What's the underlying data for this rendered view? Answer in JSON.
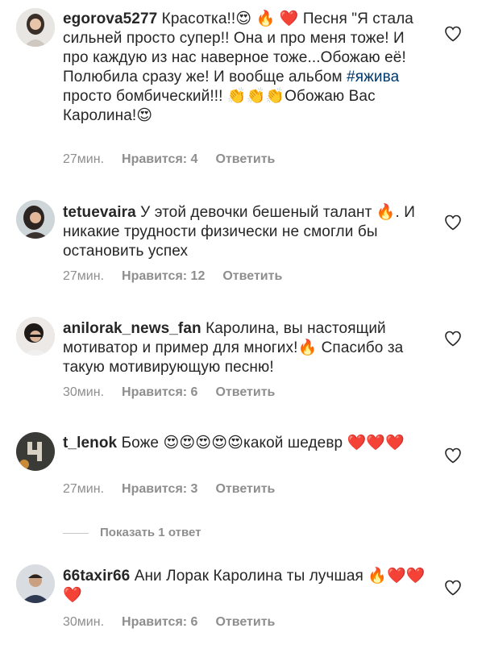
{
  "comments": [
    {
      "username": "egorova5277",
      "text_before": " Красотка!!😍 🔥 ❤️  Песня \"Я стала сильней просто супер!! Она и про меня тоже! И про каждую из нас наверное тоже...Обожаю её! Полюбила сразу же!  И вообще альбом ",
      "hashtag": "#яжива",
      "text_after": " просто бомбический!!! 👏👏👏Обожаю Вас Каролина!😍",
      "time": "27мин.",
      "likes": "Нравится: 4",
      "reply": "Ответить"
    },
    {
      "username": "tetuevaira",
      "text": " У этой девочки бешеный талант 🔥. И никакие трудности физически не смогли бы остановить успех",
      "time": "27мин.",
      "likes": "Нравится: 12",
      "reply": "Ответить"
    },
    {
      "username": "anilorak_news_fan",
      "text": " Каролина, вы настоящий мотиватор и пример для многих!🔥 Спасибо за такую мотивирующую песню!",
      "time": "30мин.",
      "likes": "Нравится: 6",
      "reply": "Ответить"
    },
    {
      "username": "t_lenok",
      "text": " Боже 😍😍😍😍😍какой шедевр ❤️❤️❤️",
      "time": "27мин.",
      "likes": "Нравится: 3",
      "reply": "Ответить",
      "view_replies": "Показать 1 ответ"
    },
    {
      "username": "66taxir66",
      "text": " Ани Лорак Каролина ты лучшая 🔥❤️❤️❤️",
      "time": "30мин.",
      "likes": "Нравится: 6",
      "reply": "Ответить"
    }
  ],
  "icons": {
    "like": "heart-outline-icon"
  },
  "colors": {
    "text": "#262626",
    "meta": "#8e8e8e",
    "hashtag": "#00376b"
  }
}
